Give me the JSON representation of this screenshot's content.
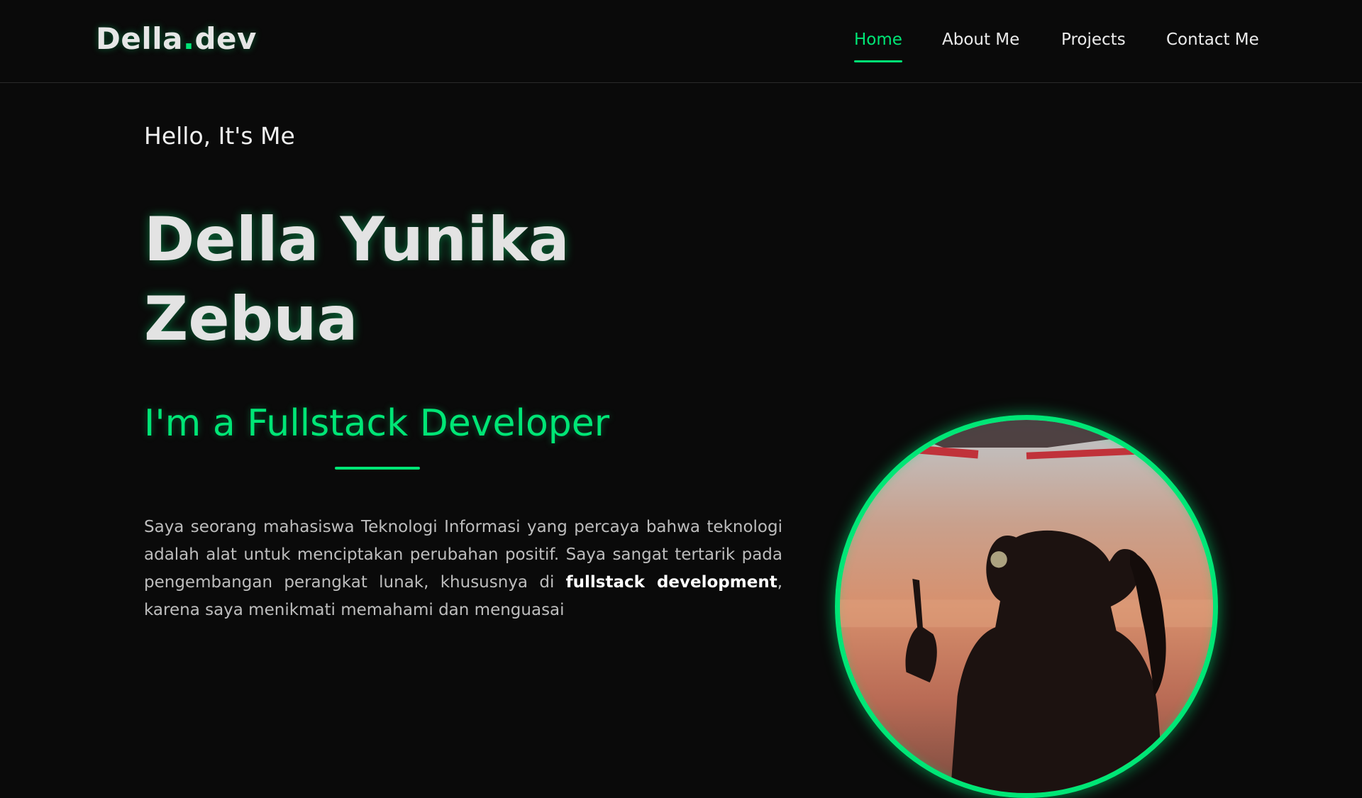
{
  "brand": {
    "name": "Della",
    "dot": ".",
    "suffix": "dev"
  },
  "nav": {
    "items": [
      {
        "label": "Home",
        "active": true
      },
      {
        "label": "About Me",
        "active": false
      },
      {
        "label": "Projects",
        "active": false
      },
      {
        "label": "Contact Me",
        "active": false
      }
    ]
  },
  "hero": {
    "greeting": "Hello, It's Me",
    "name_line1": "Della Yunika",
    "name_line2": "Zebua",
    "role": "I'm a Fullstack Developer",
    "bio_part1": "Saya seorang mahasiswa Teknologi Informasi yang percaya bahwa teknologi adalah alat untuk menciptakan perubahan positif. Saya sangat tertarik pada pengembangan perangkat lunak, khususnya di ",
    "bio_bold": "fullstack development",
    "bio_part2": ", karena saya menikmati memahami dan menguasai"
  },
  "colors": {
    "accent": "#00e676",
    "background": "#0a0a0a",
    "text": "#e6e6e6"
  },
  "icons": {
    "profile_photo": "profile-photo"
  }
}
